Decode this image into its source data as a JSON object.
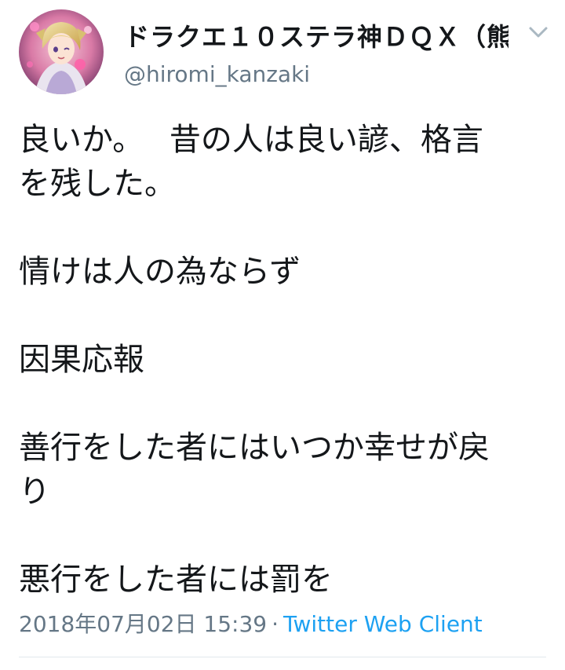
{
  "tweet": {
    "author": {
      "display_name": "ドラクエ１０ステラ神ＤＱＸ（熊…",
      "handle": "@hiromi_kanzaki",
      "avatar_icon": "anime-character-avatar-icon"
    },
    "menu_icon": "chevron-down-icon",
    "text_lines": [
      "良いか。　 昔の人は良い諺、格言",
      "を残した。",
      "",
      "情けは人の為ならず",
      "",
      "因果応報",
      "",
      "善行をした者にはいつか幸せが戻",
      "り",
      "",
      "悪行をした者には罰を"
    ],
    "timestamp": "2018年07月02日 15:39",
    "separator": "·",
    "source": "Twitter Web Client"
  },
  "colors": {
    "text": "#14171a",
    "secondary": "#657786",
    "link": "#1da1f2",
    "divider": "#e1e8ed"
  }
}
